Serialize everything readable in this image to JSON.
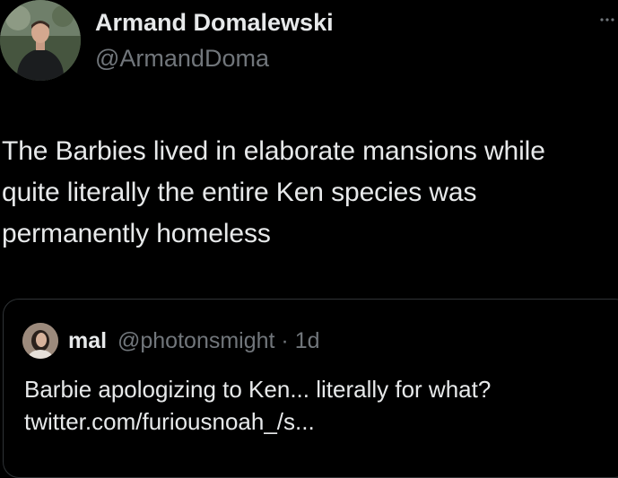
{
  "tweet": {
    "author": {
      "display_name": "Armand Domalewski",
      "handle": "@ArmandDoma"
    },
    "text_lines": [
      "The Barbies lived in elaborate mansions while",
      "quite literally the entire Ken species was",
      "permanently homeless"
    ],
    "more_icon": "more-horizontal-icon"
  },
  "quote": {
    "author": {
      "display_name": "mal",
      "handle_time": "@photonsmight · 1d"
    },
    "text_lines": [
      "Barbie apologizing to Ken... literally for what?",
      "twitter.com/furiousnoah_/s..."
    ]
  },
  "colors": {
    "background": "#000000",
    "primary_text": "#e7e9ea",
    "secondary_text": "#71767b",
    "border": "#2f3336"
  }
}
